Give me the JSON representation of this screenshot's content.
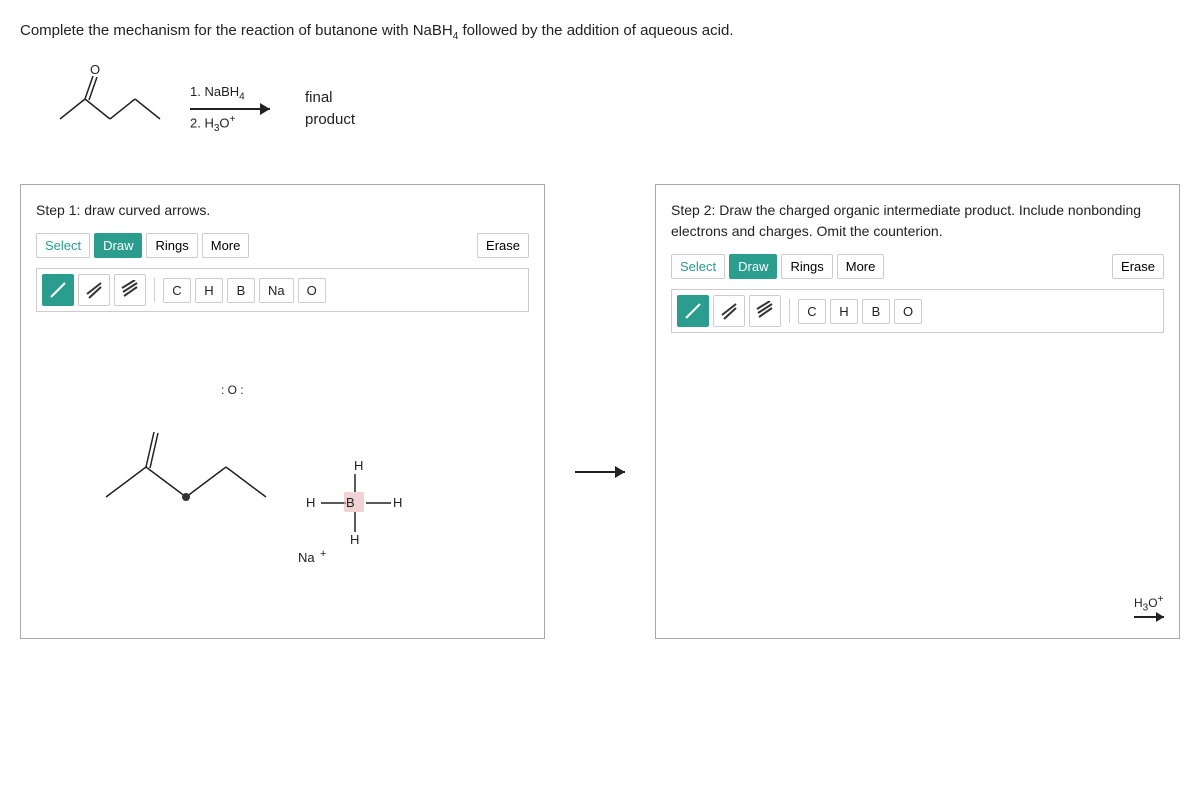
{
  "question": {
    "text": "Complete the mechanism for the reaction of butanone with NaBH₄ followed by the addition of aqueous acid.",
    "reagent1": "1. NaBH",
    "reagent1_sub": "4",
    "reagent2": "2. H₃O",
    "reagent2_sup": "+",
    "product_label": "final\nproduct"
  },
  "step1": {
    "title": "Step 1: draw curved arrows.",
    "toolbar": {
      "select": "Select",
      "draw": "Draw",
      "rings": "Rings",
      "more": "More",
      "erase": "Erase"
    },
    "atoms": [
      "C",
      "H",
      "B",
      "Na",
      "O"
    ],
    "tools": {
      "single_bond": "/",
      "double_bond": "//",
      "triple_bond": "///"
    }
  },
  "step2": {
    "title": "Step 2: Draw the charged organic intermediate product. Include nonbonding electrons and charges. Omit the counterion.",
    "toolbar": {
      "select": "Select",
      "draw": "Draw",
      "rings": "Rings",
      "more": "More",
      "erase": "Erase"
    },
    "atoms": [
      "C",
      "H",
      "B",
      "O"
    ],
    "tools": {
      "single_bond": "/",
      "double_bond": "//",
      "triple_bond": "///"
    },
    "h3o_label": "H₃O⁺"
  },
  "colors": {
    "teal": "#2a9d8f",
    "border": "#aaa",
    "highlight": "#e8b4b8"
  }
}
